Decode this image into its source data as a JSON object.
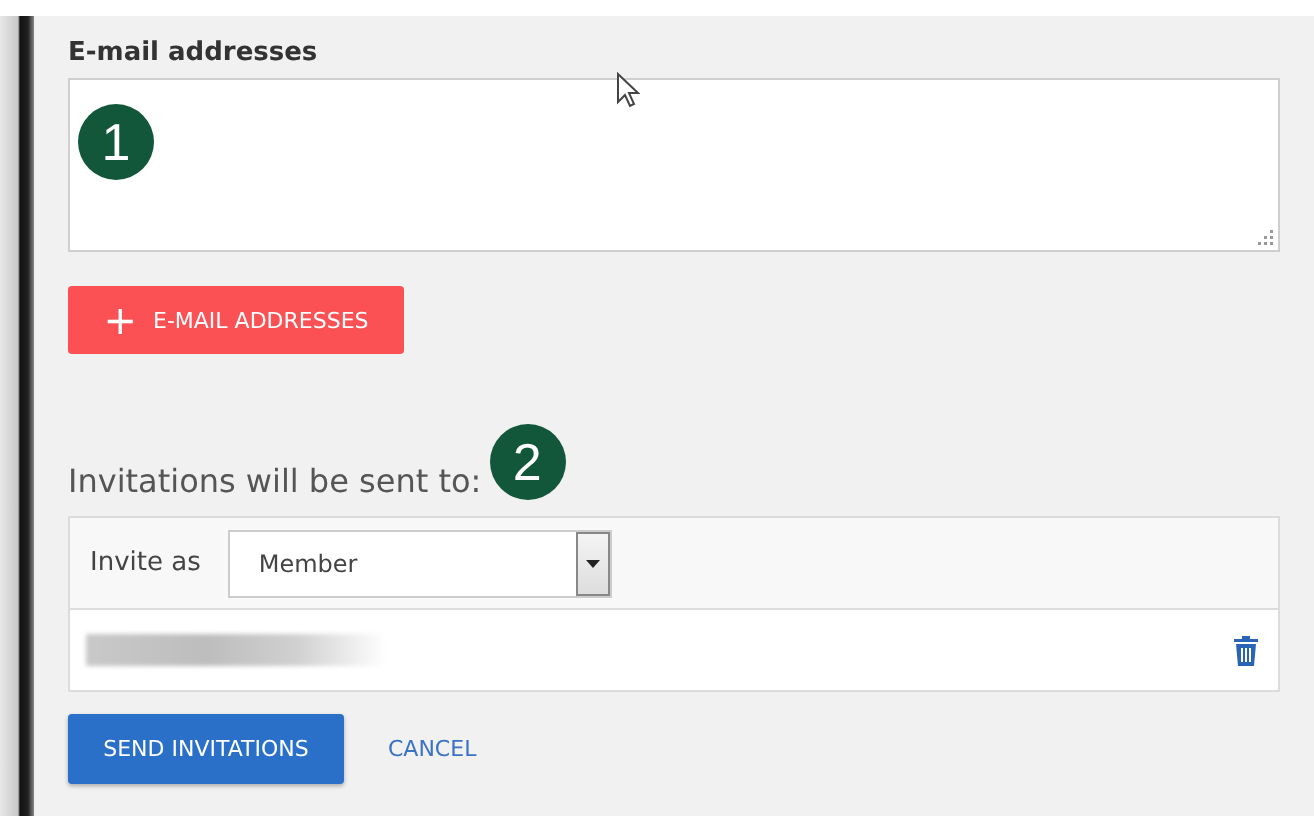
{
  "email_field": {
    "label": "E-mail addresses",
    "marker": "1"
  },
  "add_button": {
    "icon": "+",
    "label": "E-MAIL ADDRESSES"
  },
  "recipients": {
    "heading": "Invitations will be sent to:",
    "marker": "2",
    "invite_as_label": "Invite as",
    "role": "Member",
    "rows": [
      {
        "kind": "redacted"
      }
    ]
  },
  "actions": {
    "send": "SEND INVITATIONS",
    "cancel": "CANCEL"
  }
}
